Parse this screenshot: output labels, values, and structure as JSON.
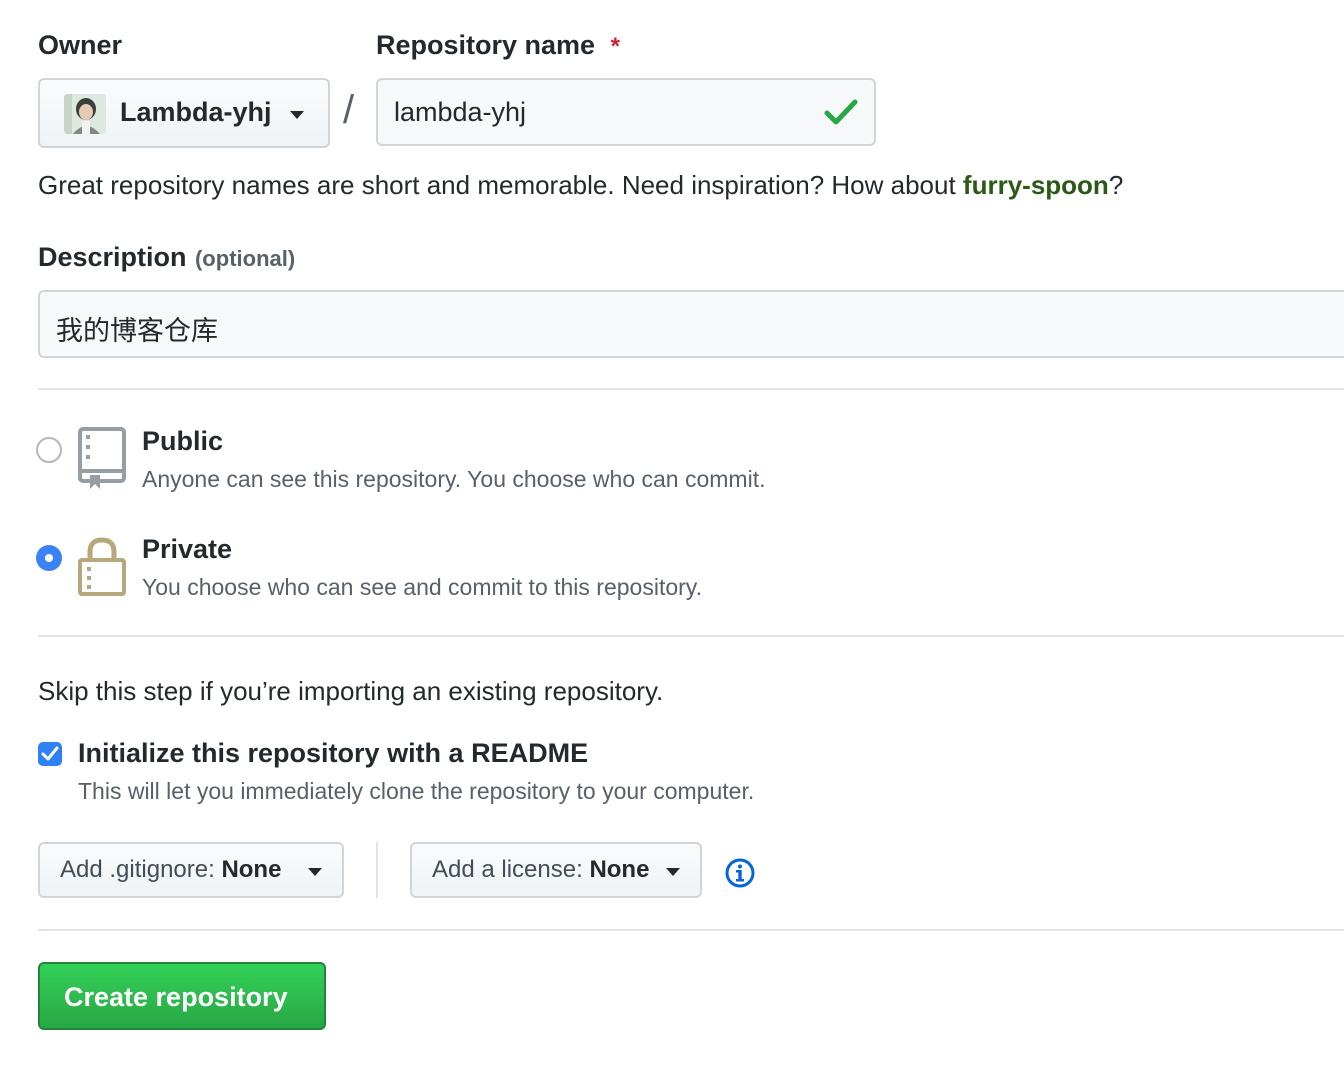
{
  "owner": {
    "label": "Owner",
    "selected": "Lambda-yhj",
    "avatar_icon": "user-avatar"
  },
  "separator": "/",
  "repo_name": {
    "label": "Repository name",
    "required_mark": "*",
    "value": "lambda-yhj",
    "status_icon": "check-icon",
    "status_color": "#28a745"
  },
  "hint": {
    "text_before": "Great repository names are short and memorable. Need inspiration? How about ",
    "suggestion": "furry-spoon",
    "text_after": "?",
    "suggestion_color": "#2b5a17"
  },
  "description": {
    "label": "Description",
    "optional": "(optional)",
    "value": "我的博客仓库"
  },
  "visibility": {
    "options": [
      {
        "title": "Public",
        "desc": "Anyone can see this repository. You choose who can commit.",
        "icon": "repo-icon",
        "checked": false
      },
      {
        "title": "Private",
        "desc": "You choose who can see and commit to this repository.",
        "icon": "lock-icon",
        "checked": true
      }
    ]
  },
  "init": {
    "skip_text": "Skip this step if you’re importing an existing repository.",
    "readme_label": "Initialize this repository with a README",
    "readme_desc": "This will let you immediately clone the repository to your computer.",
    "readme_checked": true
  },
  "gitignore": {
    "prefix": "Add .gitignore: ",
    "value": "None"
  },
  "license": {
    "prefix": "Add a license: ",
    "value": "None"
  },
  "info_icon": "info-icon",
  "submit": {
    "label": "Create repository"
  },
  "colors": {
    "accent_blue": "#2f81f7",
    "green_button": "#2ea44f",
    "lock_tan": "#b6a77d"
  }
}
